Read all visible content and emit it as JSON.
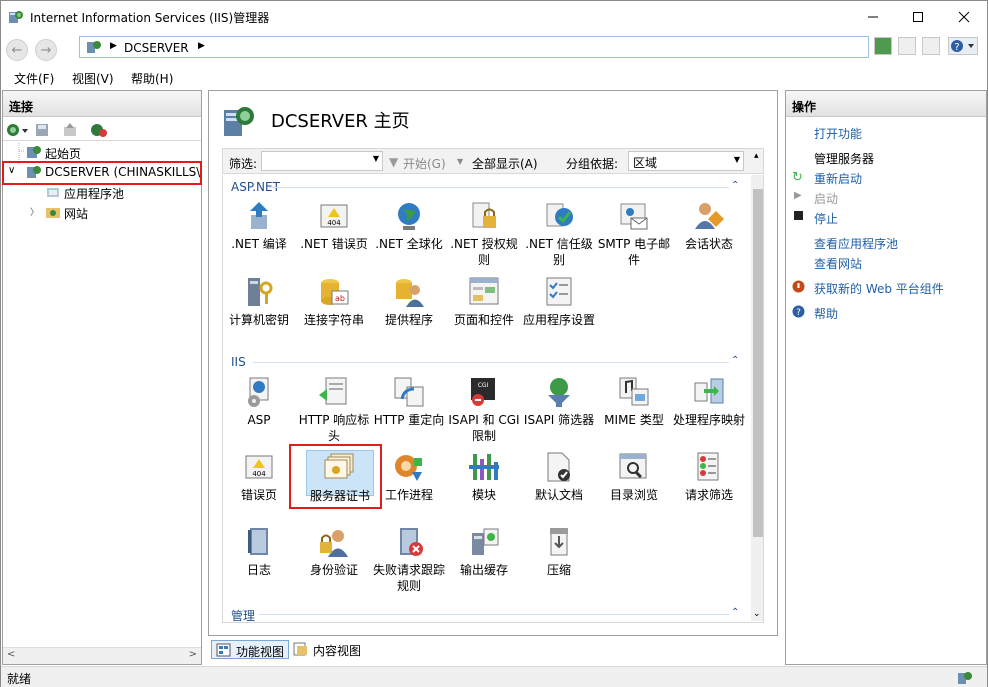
{
  "window": {
    "title": "Internet Information Services (IIS)管理器"
  },
  "address": {
    "path": "DCSERVER"
  },
  "menu": [
    {
      "label": "文件(F)"
    },
    {
      "label": "视图(V)"
    },
    {
      "label": "帮助(H)"
    }
  ],
  "connections": {
    "title": "连接",
    "tree": [
      {
        "label": "起始页"
      },
      {
        "label": "DCSERVER (CHINASKILLS\\"
      },
      {
        "label": "应用程序池"
      },
      {
        "label": "网站"
      }
    ]
  },
  "center": {
    "title": "DCSERVER 主页",
    "filter": {
      "label": "筛选:",
      "start": "开始(G)",
      "show_all": "全部显示(A)",
      "group_label": "分组依据:",
      "group_value": "区域"
    },
    "sections": [
      {
        "name": "ASP.NET",
        "items": [
          {
            "label": ".NET 编译"
          },
          {
            "label": ".NET 错误页"
          },
          {
            "label": ".NET 全球化"
          },
          {
            "label": ".NET 授权规则"
          },
          {
            "label": ".NET 信任级别"
          },
          {
            "label": "SMTP 电子邮件"
          },
          {
            "label": "会话状态"
          },
          {
            "label": "计算机密钥"
          },
          {
            "label": "连接字符串"
          },
          {
            "label": "提供程序"
          },
          {
            "label": "页面和控件"
          },
          {
            "label": "应用程序设置"
          }
        ]
      },
      {
        "name": "IIS",
        "items": [
          {
            "label": "ASP"
          },
          {
            "label": "HTTP 响应标头"
          },
          {
            "label": "HTTP 重定向"
          },
          {
            "label": "ISAPI 和 CGI 限制"
          },
          {
            "label": "ISAPI 筛选器"
          },
          {
            "label": "MIME 类型"
          },
          {
            "label": "处理程序映射"
          },
          {
            "label": "错误页"
          },
          {
            "label": "服务器证书"
          },
          {
            "label": "工作进程"
          },
          {
            "label": "模块"
          },
          {
            "label": "默认文档"
          },
          {
            "label": "目录浏览"
          },
          {
            "label": "请求筛选"
          },
          {
            "label": "日志"
          },
          {
            "label": "身份验证"
          },
          {
            "label": "失败请求跟踪规则"
          },
          {
            "label": "输出缓存"
          },
          {
            "label": "压缩"
          }
        ]
      },
      {
        "name": "管理",
        "items": []
      }
    ],
    "tabs": [
      {
        "label": "功能视图"
      },
      {
        "label": "内容视图"
      }
    ]
  },
  "actions": {
    "title": "操作",
    "items": [
      {
        "label": "打开功能"
      },
      {
        "label": "管理服务器"
      },
      {
        "label": "重新启动"
      },
      {
        "label": "启动"
      },
      {
        "label": "停止"
      },
      {
        "label": "查看应用程序池"
      },
      {
        "label": "查看网站"
      },
      {
        "label": "获取新的 Web 平台组件"
      },
      {
        "label": "帮助"
      }
    ]
  },
  "status": {
    "text": "就绪"
  },
  "colors": {
    "highlight": "#e31b1b",
    "link": "#1f5fa8",
    "selected": "#cce4f7"
  }
}
